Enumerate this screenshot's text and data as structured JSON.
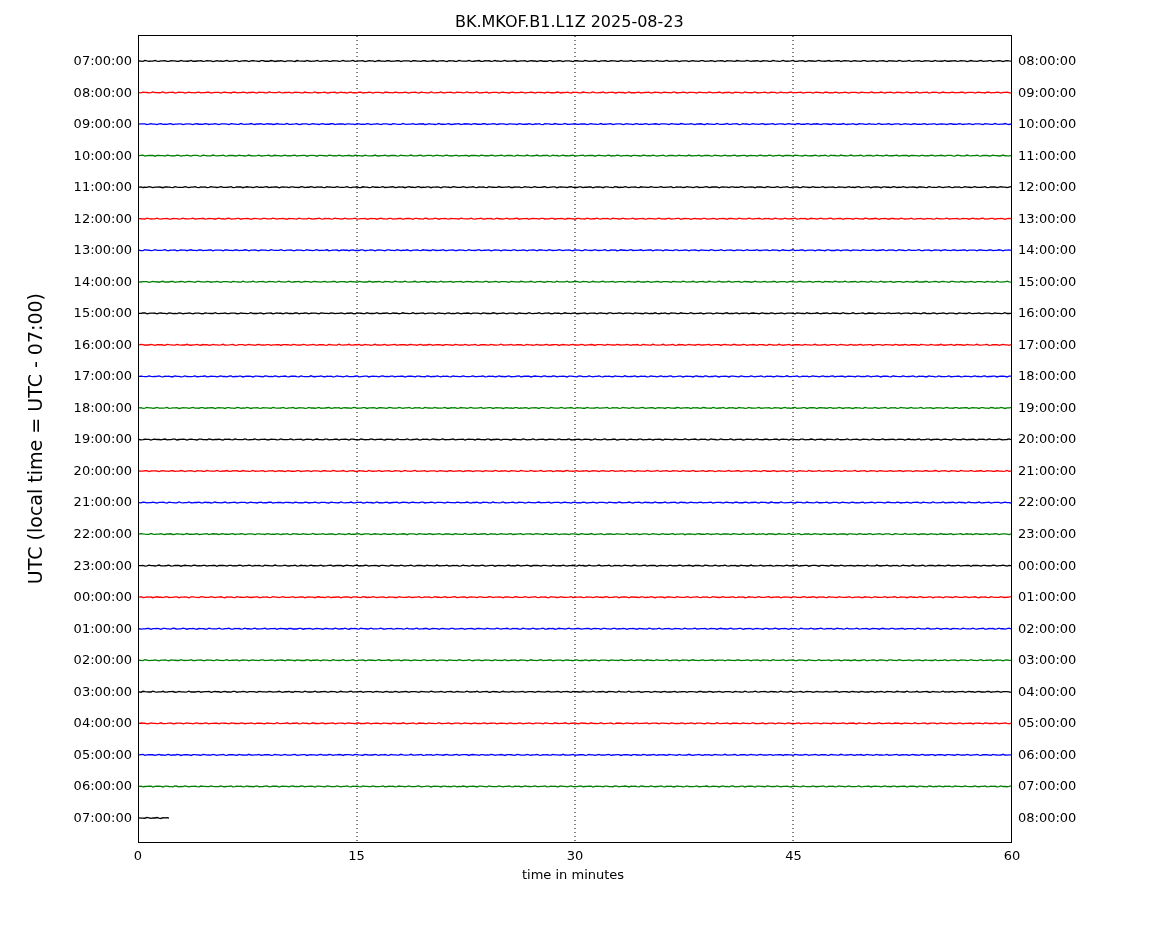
{
  "title": "BK.MKOF.B1.L1Z 2025-08-23",
  "ylabel": "UTC (local time = UTC - 07:00)",
  "xlabel": "time in minutes",
  "xticks": [
    "0",
    "15",
    "30",
    "45",
    "60"
  ],
  "traces": [
    {
      "left": "07:00:00",
      "right": "08:00:00",
      "color": "#000000",
      "level": 1
    },
    {
      "left": "08:00:00",
      "right": "09:00:00",
      "color": "#ff0000",
      "level": 1
    },
    {
      "left": "09:00:00",
      "right": "10:00:00",
      "color": "#0000ff",
      "level": 1
    },
    {
      "left": "10:00:00",
      "right": "11:00:00",
      "color": "#008000",
      "level": 1
    },
    {
      "left": "11:00:00",
      "right": "12:00:00",
      "color": "#000000",
      "level": 1
    },
    {
      "left": "12:00:00",
      "right": "13:00:00",
      "color": "#ff0000",
      "level": 1
    },
    {
      "left": "13:00:00",
      "right": "14:00:00",
      "color": "#0000ff",
      "level": 1
    },
    {
      "left": "14:00:00",
      "right": "15:00:00",
      "color": "#008000",
      "level": 1
    },
    {
      "left": "15:00:00",
      "right": "16:00:00",
      "color": "#000000",
      "level": 1
    },
    {
      "left": "16:00:00",
      "right": "17:00:00",
      "color": "#ff0000",
      "level": 1
    },
    {
      "left": "17:00:00",
      "right": "18:00:00",
      "color": "#0000ff",
      "level": 1
    },
    {
      "left": "18:00:00",
      "right": "19:00:00",
      "color": "#008000",
      "level": 1
    },
    {
      "left": "19:00:00",
      "right": "20:00:00",
      "color": "#000000",
      "level": 1
    },
    {
      "left": "20:00:00",
      "right": "21:00:00",
      "color": "#ff0000",
      "level": 1
    },
    {
      "left": "21:00:00",
      "right": "22:00:00",
      "color": "#0000ff",
      "level": 1
    },
    {
      "left": "22:00:00",
      "right": "23:00:00",
      "color": "#008000",
      "level": 1
    },
    {
      "left": "23:00:00",
      "right": "00:00:00",
      "color": "#000000",
      "level": 1
    },
    {
      "left": "00:00:00",
      "right": "01:00:00",
      "color": "#ff0000",
      "level": 1
    },
    {
      "left": "01:00:00",
      "right": "02:00:00",
      "color": "#0000ff",
      "level": 1
    },
    {
      "left": "02:00:00",
      "right": "03:00:00",
      "color": "#008000",
      "level": 1
    },
    {
      "left": "03:00:00",
      "right": "04:00:00",
      "color": "#000000",
      "level": 1
    },
    {
      "left": "04:00:00",
      "right": "05:00:00",
      "color": "#ff0000",
      "level": 1
    },
    {
      "left": "05:00:00",
      "right": "06:00:00",
      "color": "#0000ff",
      "level": 1
    },
    {
      "left": "06:00:00",
      "right": "07:00:00",
      "color": "#008000",
      "level": 1
    },
    {
      "left": "07:00:00",
      "right": "08:00:00",
      "color": "#000000",
      "level": 0.035
    }
  ]
}
